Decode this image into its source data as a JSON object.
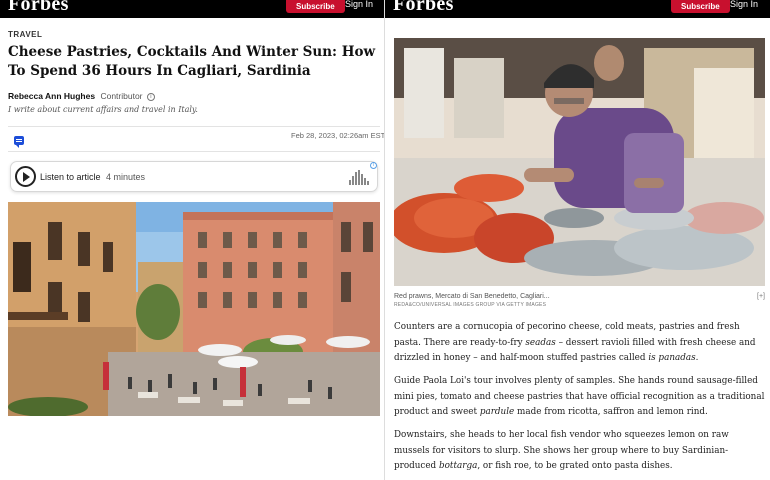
{
  "header": {
    "logo": "Forbes",
    "subscribe_label": "Subscribe",
    "signin_label": "Sign In"
  },
  "article": {
    "section": "TRAVEL",
    "headline": "Cheese Pastries, Cocktails And Winter Sun: How To Spend 36 Hours In Cagliari, Sardinia",
    "author": "Rebecca Ann Hughes",
    "author_role": "Contributor",
    "author_bio": "I write about current affairs and travel in Italy.",
    "date": "Feb 28, 2023, 02:26am EST",
    "listen_label": "Listen to article",
    "listen_duration": "4 minutes"
  },
  "photo": {
    "caption": "Red prawns, Mercato di San Benedetto, Cagliari...",
    "credit": "REDA&CO/UNIVERSAL IMAGES GROUP VIA GETTY IMAGES",
    "expand_label": "[+]"
  },
  "body": {
    "p1a": "Counters are a cornucopia of pecorino cheese, cold meats, pastries and fresh pasta. There are ready-to-fry ",
    "p1b": "seadas",
    "p1c": " – dessert ravioli filled with fresh cheese and drizzled in honey – and half-moon stuffed pastries called ",
    "p1d": "is panadas",
    "p1e": ".",
    "p2a": "Guide Paola Loi's tour involves plenty of samples. She hands round sausage-filled mini pies, tomato and cheese pastries that have official recognition as a traditional product and sweet ",
    "p2b": "pardule",
    "p2c": " made from ricotta, saffron and lemon rind.",
    "p3a": "Downstairs, she heads to her local fish vendor who squeezes lemon on raw mussels for visitors to slurp. She shows her group where to buy Sardinian-produced ",
    "p3b": "bottarga",
    "p3c": ", or fish roe, to be grated onto pasta dishes."
  },
  "colors": {
    "brand_bar": "#000000",
    "subscribe": "#c8102e",
    "comment_icon": "#1d4ed8"
  }
}
